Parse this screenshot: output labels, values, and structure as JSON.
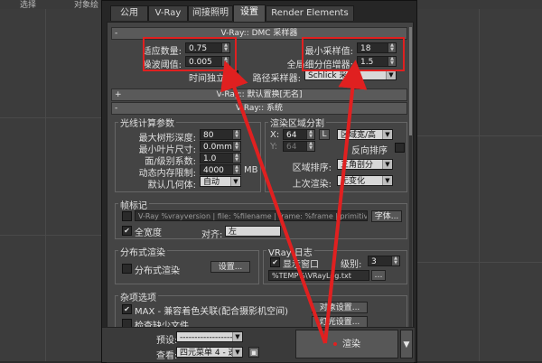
{
  "background": {
    "top_left_tab": "选择",
    "top_left_tab2": "对象绘"
  },
  "tabs": [
    {
      "label": "公用"
    },
    {
      "label": "V-Ray"
    },
    {
      "label": "间接照明"
    },
    {
      "label": "设置"
    },
    {
      "label": "Render Elements"
    }
  ],
  "dmc": {
    "title": "V-Ray:: DMC 采样器",
    "adaptive_amount_label": "适应数量:",
    "adaptive_amount": "0.75",
    "noise_threshold_label": "噪波阈值:",
    "noise_threshold": "0.005",
    "time_independent_label": "时间独立",
    "time_independent_checked": "✔",
    "min_samples_label": "最小采样值:",
    "min_samples": "18",
    "global_subdiv_label": "全局细分倍增器:",
    "global_subdiv": "1.5",
    "path_sampler_label": "路径采样器:",
    "path_sampler": "Schlick 采样"
  },
  "displace": {
    "title": "V-Ray:: 默认置换[无名]"
  },
  "system": {
    "title": "V-Ray:: 系统",
    "raycast": {
      "title": "光线计算参数",
      "max_tree_depth_label": "最大树形深度:",
      "max_tree_depth": "80",
      "min_leaf_label": "最小叶片尺寸:",
      "min_leaf": "0.0mm",
      "face_level_label": "面/级别系数:",
      "face_level": "1.0",
      "mem_limit_label": "动态内存限制:",
      "mem_limit": "4000",
      "mem_unit": "MB",
      "default_geom_label": "默认几何体:",
      "default_geom": "自动"
    },
    "region": {
      "title": "渲染区域分割",
      "x_label": "X:",
      "x_value": "64",
      "y_label": "Y:",
      "y_value": "64",
      "lock_label": "L",
      "mode": "区域宽/高",
      "reverse_label": "反向排序",
      "order_label": "区域排序:",
      "order": "三角剖分",
      "prev_label": "上次渲染:",
      "prev": "无变化"
    },
    "stamp": {
      "title": "帧标记",
      "text": "V-Ray %vrayversion | file: %filename | frame: %frame | primitives: %p",
      "font_button": "字体...",
      "full_width_label": "全宽度",
      "align_label": "对齐:",
      "align_value": "左"
    },
    "distributed": {
      "title": "分布式渲染",
      "check_label": "分布式渲染",
      "settings_button": "设置..."
    },
    "log": {
      "title": "VRay 日志",
      "show_window_label": "显示窗口",
      "level_label": "级别:",
      "level": "3",
      "path": "%TEMP%\\VRayLog.txt"
    },
    "misc": {
      "title": "杂项选项",
      "max_compat_label": "MAX - 兼容着色关联(配合摄影机空间)",
      "check_missing_label": "检查缺少文件",
      "object_settings_button": "对象设置...",
      "light_settings_button": "灯光设置..."
    }
  },
  "footer": {
    "preset_label": "预设:",
    "preset_value": "----------------------------",
    "view_label": "查看:",
    "view_value": "四元菜单 4 - 透",
    "render_button": "渲染"
  },
  "colors": {
    "highlight": "#e02020",
    "panel": "#444444"
  }
}
